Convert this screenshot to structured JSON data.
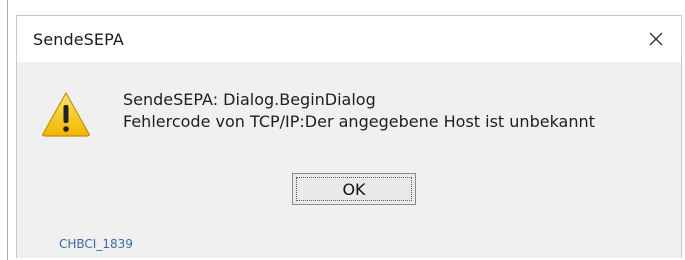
{
  "window": {
    "title": "SendeSEPA",
    "close_label": "×"
  },
  "icon": "warning-triangle-icon",
  "message": {
    "line1": "SendeSEPA: Dialog.BeginDialog",
    "line2": "Fehlercode von TCP/IP:Der angegebene Host ist unbekannt"
  },
  "buttons": {
    "ok_label": "OK"
  },
  "footer": {
    "code": "CHBCI_1839"
  },
  "colors": {
    "dialog_bg": "#f0f0f0",
    "titlebar_bg": "#ffffff",
    "warning_yellow": "#f3c200",
    "footer_text": "#3a6aa8"
  }
}
